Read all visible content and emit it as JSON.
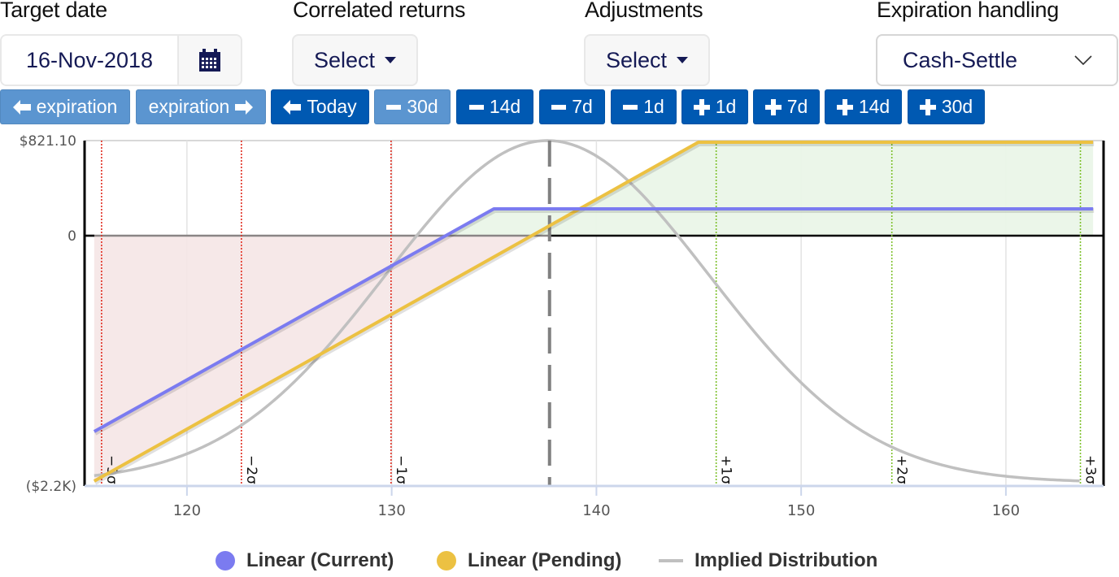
{
  "controls": {
    "target_date": {
      "label": "Target date",
      "value": "16-Nov-2018",
      "icon": "calendar-icon"
    },
    "correlated_returns": {
      "label": "Correlated returns",
      "value": "Select"
    },
    "adjustments": {
      "label": "Adjustments",
      "value": "Select"
    },
    "expiration_handling": {
      "label": "Expiration handling",
      "value": "Cash-Settle"
    }
  },
  "date_buttons": [
    {
      "label": "expiration",
      "icon": "arrow-left",
      "style": "light"
    },
    {
      "label": "expiration",
      "icon": "arrow-right",
      "style": "light"
    },
    {
      "label": "Today",
      "icon": "arrow-left",
      "style": "dark"
    },
    {
      "label": "30d",
      "icon": "minus",
      "style": "light"
    },
    {
      "label": "14d",
      "icon": "minus",
      "style": "dark"
    },
    {
      "label": "7d",
      "icon": "minus",
      "style": "dark"
    },
    {
      "label": "1d",
      "icon": "minus",
      "style": "dark"
    },
    {
      "label": "1d",
      "icon": "plus",
      "style": "dark"
    },
    {
      "label": "7d",
      "icon": "plus",
      "style": "dark"
    },
    {
      "label": "14d",
      "icon": "plus",
      "style": "dark"
    },
    {
      "label": "30d",
      "icon": "plus",
      "style": "dark"
    }
  ],
  "colors": {
    "dark_button": "#0059b2",
    "light_button": "#5b95d0",
    "current": "#7b7bf0",
    "pending": "#ecc142",
    "distribution": "#c0c0c0",
    "loss_fill": "#f5e6e6",
    "profit_fill": "#eaf5e8",
    "neg_sigma": "#e02b1e",
    "pos_sigma": "#7dc02a"
  },
  "chart_data": {
    "type": "line",
    "title": "",
    "xlabel": "",
    "ylabel": "",
    "xlim": [
      115.0,
      164.77
    ],
    "ylim": [
      -2161,
      821.1
    ],
    "x_ticks": [
      120,
      130,
      140,
      150,
      160
    ],
    "x_tick_labels": [
      "120",
      "130",
      "140",
      "150",
      "160"
    ],
    "y_ticks": [
      821.1,
      0,
      -2161
    ],
    "y_tick_labels": [
      "$821.10",
      "0",
      "($2.2K)"
    ],
    "grid": "vertical",
    "legend_position": "bottom",
    "series": [
      {
        "name": "Linear (Current)",
        "points": [
          [
            115.47,
            -1691
          ],
          [
            134.99,
            231.6
          ],
          [
            164.26,
            231.6
          ]
        ]
      },
      {
        "name": "Linear (Pending)",
        "points": [
          [
            115.47,
            -2119
          ],
          [
            144.98,
            807
          ],
          [
            164.26,
            807
          ]
        ]
      },
      {
        "name": "Implied Distribution",
        "mean": 137.6,
        "sd": 7.9,
        "range": [
          115.47,
          163.6
        ],
        "peak_value": 821.1,
        "base_value": -2130
      }
    ],
    "sigma_lines": [
      {
        "label": "−3σ",
        "x": 115.83,
        "side": "neg"
      },
      {
        "label": "−2σ",
        "x": 122.66,
        "side": "neg"
      },
      {
        "label": "−1σ",
        "x": 129.97,
        "side": "neg"
      },
      {
        "label": "+1σ",
        "x": 145.85,
        "side": "pos"
      },
      {
        "label": "+2σ",
        "x": 154.43,
        "side": "pos"
      },
      {
        "label": "+3σ",
        "x": 163.64,
        "side": "pos"
      }
    ],
    "current_price": 137.71
  },
  "legend": [
    {
      "name": "Linear (Current)",
      "marker": "dot"
    },
    {
      "name": "Linear (Pending)",
      "marker": "dot"
    },
    {
      "name": "Implied Distribution",
      "marker": "line"
    }
  ]
}
